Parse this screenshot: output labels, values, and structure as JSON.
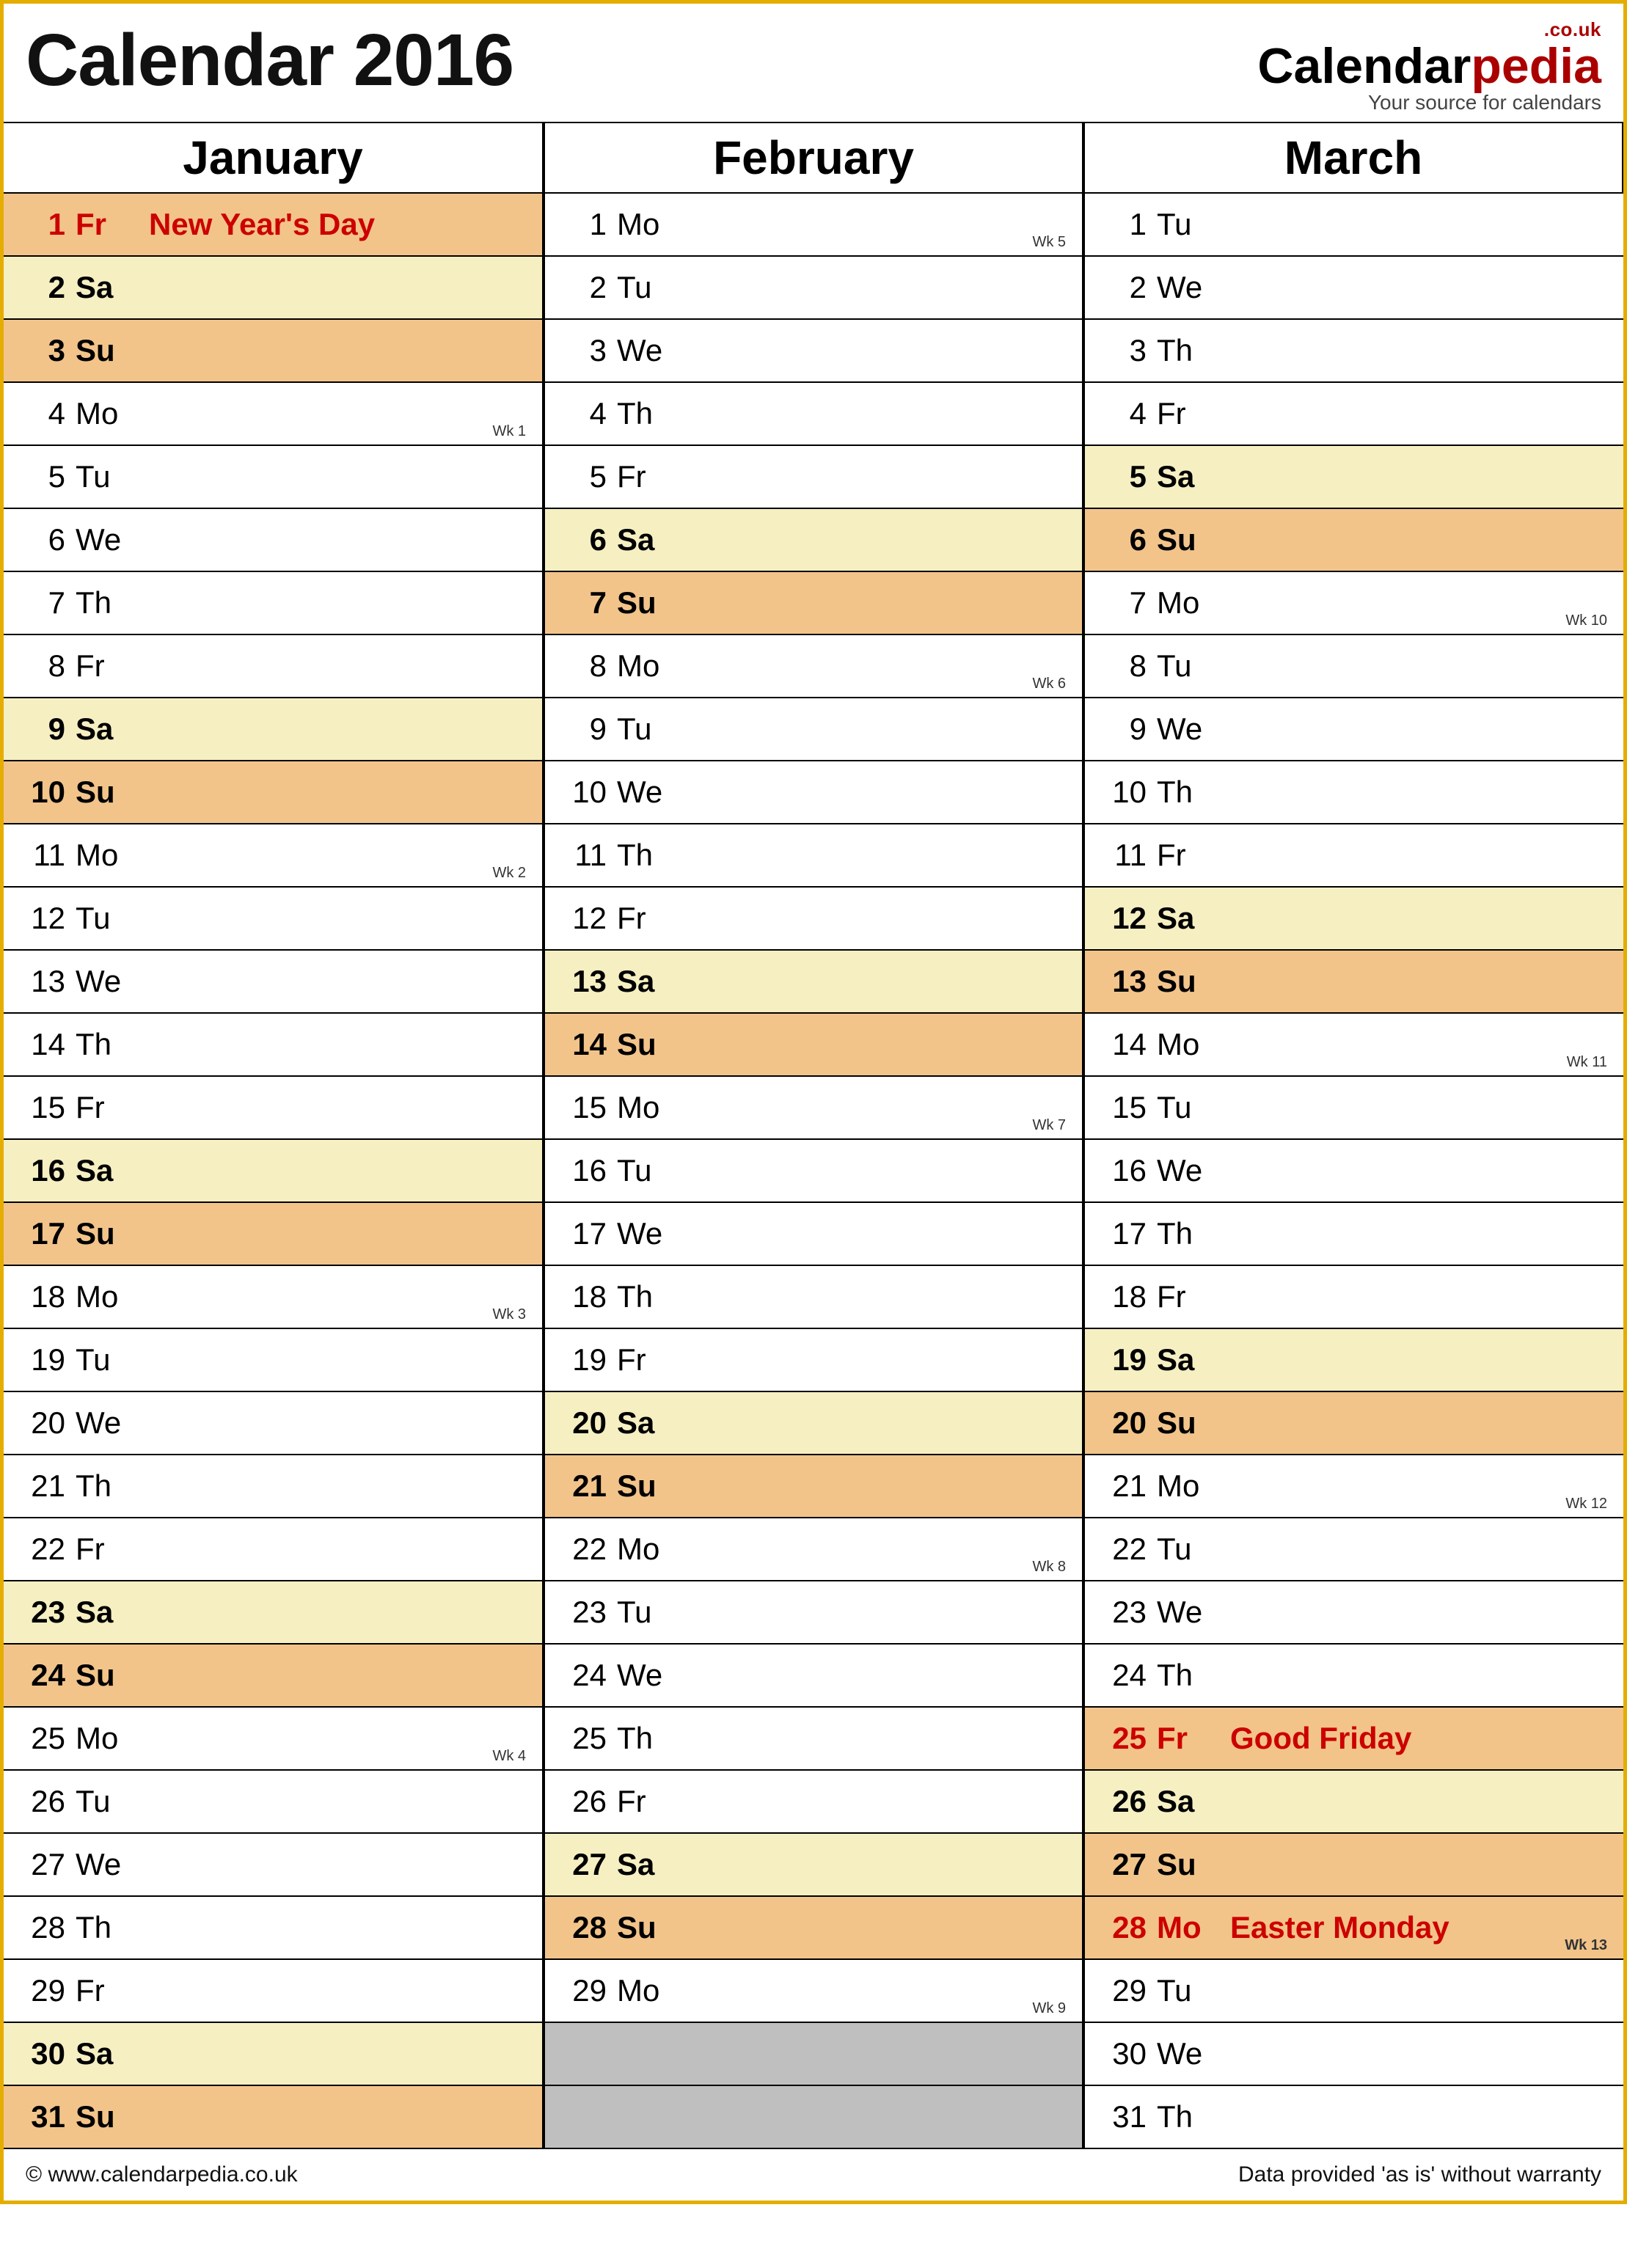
{
  "title": "Calendar 2016",
  "logo": {
    "sup": ".co.uk",
    "part1": "Calendar",
    "part2": "pedia",
    "sub": "Your source for calendars"
  },
  "months": [
    "January",
    "February",
    "March"
  ],
  "cols": [
    [
      {
        "n": "1",
        "d": "Fr",
        "t": "hol",
        "ev": "New Year's Day"
      },
      {
        "n": "2",
        "d": "Sa",
        "t": "sat"
      },
      {
        "n": "3",
        "d": "Su",
        "t": "sun"
      },
      {
        "n": "4",
        "d": "Mo",
        "wk": "Wk 1"
      },
      {
        "n": "5",
        "d": "Tu"
      },
      {
        "n": "6",
        "d": "We"
      },
      {
        "n": "7",
        "d": "Th"
      },
      {
        "n": "8",
        "d": "Fr"
      },
      {
        "n": "9",
        "d": "Sa",
        "t": "sat"
      },
      {
        "n": "10",
        "d": "Su",
        "t": "sun"
      },
      {
        "n": "11",
        "d": "Mo",
        "wk": "Wk 2"
      },
      {
        "n": "12",
        "d": "Tu"
      },
      {
        "n": "13",
        "d": "We"
      },
      {
        "n": "14",
        "d": "Th"
      },
      {
        "n": "15",
        "d": "Fr"
      },
      {
        "n": "16",
        "d": "Sa",
        "t": "sat"
      },
      {
        "n": "17",
        "d": "Su",
        "t": "sun"
      },
      {
        "n": "18",
        "d": "Mo",
        "wk": "Wk 3"
      },
      {
        "n": "19",
        "d": "Tu"
      },
      {
        "n": "20",
        "d": "We"
      },
      {
        "n": "21",
        "d": "Th"
      },
      {
        "n": "22",
        "d": "Fr"
      },
      {
        "n": "23",
        "d": "Sa",
        "t": "sat"
      },
      {
        "n": "24",
        "d": "Su",
        "t": "sun"
      },
      {
        "n": "25",
        "d": "Mo",
        "wk": "Wk 4"
      },
      {
        "n": "26",
        "d": "Tu"
      },
      {
        "n": "27",
        "d": "We"
      },
      {
        "n": "28",
        "d": "Th"
      },
      {
        "n": "29",
        "d": "Fr"
      },
      {
        "n": "30",
        "d": "Sa",
        "t": "sat"
      },
      {
        "n": "31",
        "d": "Su",
        "t": "sun"
      }
    ],
    [
      {
        "n": "1",
        "d": "Mo",
        "wk": "Wk 5"
      },
      {
        "n": "2",
        "d": "Tu"
      },
      {
        "n": "3",
        "d": "We"
      },
      {
        "n": "4",
        "d": "Th"
      },
      {
        "n": "5",
        "d": "Fr"
      },
      {
        "n": "6",
        "d": "Sa",
        "t": "sat"
      },
      {
        "n": "7",
        "d": "Su",
        "t": "sun"
      },
      {
        "n": "8",
        "d": "Mo",
        "wk": "Wk 6"
      },
      {
        "n": "9",
        "d": "Tu"
      },
      {
        "n": "10",
        "d": "We"
      },
      {
        "n": "11",
        "d": "Th"
      },
      {
        "n": "12",
        "d": "Fr"
      },
      {
        "n": "13",
        "d": "Sa",
        "t": "sat"
      },
      {
        "n": "14",
        "d": "Su",
        "t": "sun"
      },
      {
        "n": "15",
        "d": "Mo",
        "wk": "Wk 7"
      },
      {
        "n": "16",
        "d": "Tu"
      },
      {
        "n": "17",
        "d": "We"
      },
      {
        "n": "18",
        "d": "Th"
      },
      {
        "n": "19",
        "d": "Fr"
      },
      {
        "n": "20",
        "d": "Sa",
        "t": "sat"
      },
      {
        "n": "21",
        "d": "Su",
        "t": "sun"
      },
      {
        "n": "22",
        "d": "Mo",
        "wk": "Wk 8"
      },
      {
        "n": "23",
        "d": "Tu"
      },
      {
        "n": "24",
        "d": "We"
      },
      {
        "n": "25",
        "d": "Th"
      },
      {
        "n": "26",
        "d": "Fr"
      },
      {
        "n": "27",
        "d": "Sa",
        "t": "sat"
      },
      {
        "n": "28",
        "d": "Su",
        "t": "sun"
      },
      {
        "n": "29",
        "d": "Mo",
        "wk": "Wk 9"
      },
      {
        "t": "blank"
      },
      {
        "t": "blank"
      }
    ],
    [
      {
        "n": "1",
        "d": "Tu"
      },
      {
        "n": "2",
        "d": "We"
      },
      {
        "n": "3",
        "d": "Th"
      },
      {
        "n": "4",
        "d": "Fr"
      },
      {
        "n": "5",
        "d": "Sa",
        "t": "sat"
      },
      {
        "n": "6",
        "d": "Su",
        "t": "sun"
      },
      {
        "n": "7",
        "d": "Mo",
        "wk": "Wk 10"
      },
      {
        "n": "8",
        "d": "Tu"
      },
      {
        "n": "9",
        "d": "We"
      },
      {
        "n": "10",
        "d": "Th"
      },
      {
        "n": "11",
        "d": "Fr"
      },
      {
        "n": "12",
        "d": "Sa",
        "t": "sat"
      },
      {
        "n": "13",
        "d": "Su",
        "t": "sun"
      },
      {
        "n": "14",
        "d": "Mo",
        "wk": "Wk 11"
      },
      {
        "n": "15",
        "d": "Tu"
      },
      {
        "n": "16",
        "d": "We"
      },
      {
        "n": "17",
        "d": "Th"
      },
      {
        "n": "18",
        "d": "Fr"
      },
      {
        "n": "19",
        "d": "Sa",
        "t": "sat"
      },
      {
        "n": "20",
        "d": "Su",
        "t": "sun"
      },
      {
        "n": "21",
        "d": "Mo",
        "wk": "Wk 12"
      },
      {
        "n": "22",
        "d": "Tu"
      },
      {
        "n": "23",
        "d": "We"
      },
      {
        "n": "24",
        "d": "Th"
      },
      {
        "n": "25",
        "d": "Fr",
        "t": "hol",
        "ev": "Good Friday"
      },
      {
        "n": "26",
        "d": "Sa",
        "t": "sat"
      },
      {
        "n": "27",
        "d": "Su",
        "t": "sun"
      },
      {
        "n": "28",
        "d": "Mo",
        "t": "hol",
        "ev": "Easter Monday",
        "wk": "Wk 13"
      },
      {
        "n": "29",
        "d": "Tu"
      },
      {
        "n": "30",
        "d": "We"
      },
      {
        "n": "31",
        "d": "Th"
      }
    ]
  ],
  "footer": {
    "left": "© www.calendarpedia.co.uk",
    "right": "Data provided 'as is' without warranty"
  }
}
